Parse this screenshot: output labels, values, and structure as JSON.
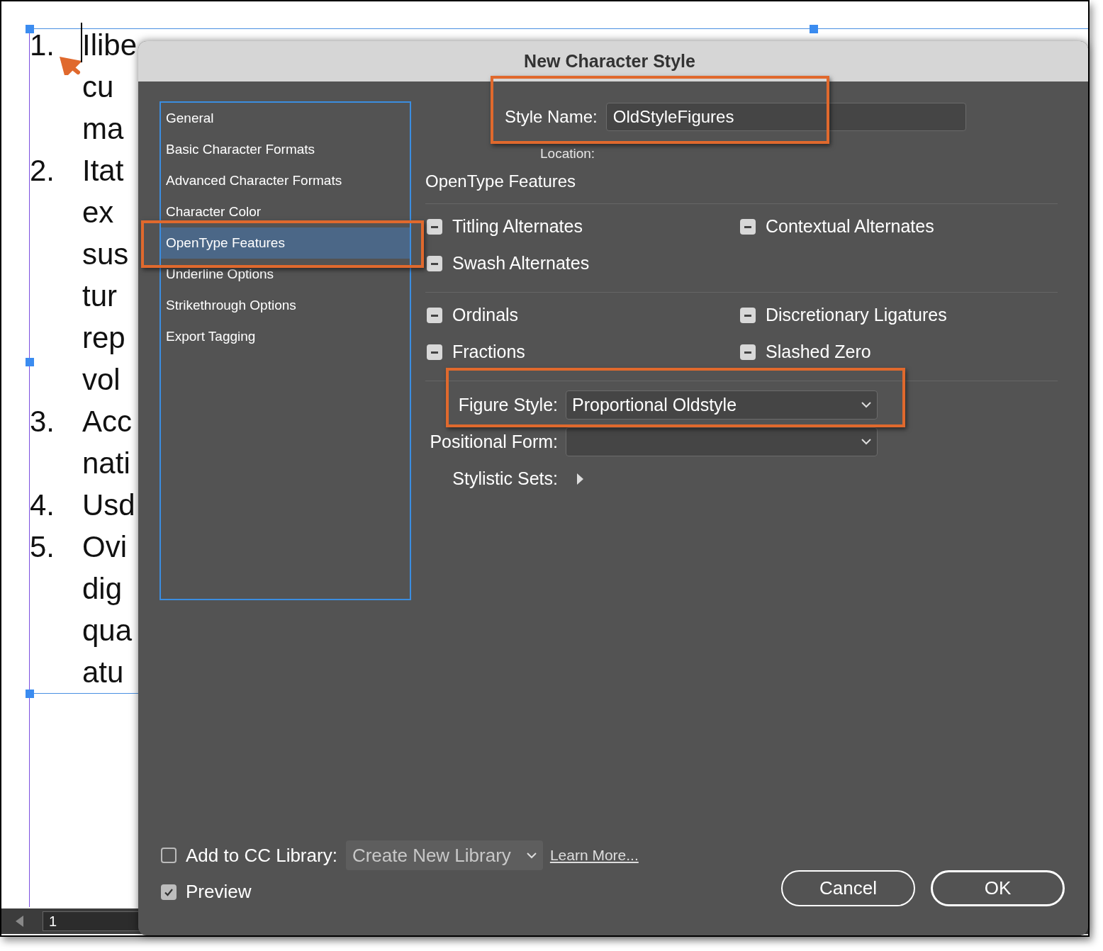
{
  "document": {
    "lines": [
      {
        "number": "1.",
        "text": "Ilibe"
      },
      {
        "text": "cu"
      },
      {
        "text": "ma"
      },
      {
        "number": "2.",
        "text": "Itat"
      },
      {
        "text": "ex"
      },
      {
        "text": "sus"
      },
      {
        "text": "tur"
      },
      {
        "text": "rep"
      },
      {
        "text": "vol"
      },
      {
        "number": "3.",
        "text": "Acc"
      },
      {
        "text": "nati"
      },
      {
        "number": "4.",
        "text": "Usd"
      },
      {
        "number": "5.",
        "text": "Ovi"
      },
      {
        "text": "dig"
      },
      {
        "text": "qua"
      },
      {
        "text": "atu"
      }
    ],
    "page_field": "1"
  },
  "dialog": {
    "title": "New Character Style",
    "sidebar": [
      {
        "label": "General",
        "selected": false
      },
      {
        "label": "Basic Character Formats",
        "selected": false
      },
      {
        "label": "Advanced Character Formats",
        "selected": false
      },
      {
        "label": "Character Color",
        "selected": false
      },
      {
        "label": "OpenType Features",
        "selected": true
      },
      {
        "label": "Underline Options",
        "selected": false
      },
      {
        "label": "Strikethrough Options",
        "selected": false
      },
      {
        "label": "Export Tagging",
        "selected": false
      }
    ],
    "style_name": {
      "label": "Style Name:",
      "value": "OldStyleFigures"
    },
    "location_label": "Location:",
    "section_title": "OpenType Features",
    "feature_groups": [
      [
        {
          "label": "Titling Alternates",
          "mixed": true
        },
        {
          "label": "Contextual Alternates",
          "mixed": true
        },
        {
          "label": "Swash Alternates",
          "mixed": true
        }
      ],
      [
        {
          "label": "Ordinals",
          "mixed": true
        },
        {
          "label": "Discretionary Ligatures",
          "mixed": true
        },
        {
          "label": "Fractions",
          "mixed": true
        },
        {
          "label": "Slashed Zero",
          "mixed": true
        }
      ]
    ],
    "figure_style": {
      "label": "Figure Style:",
      "value": "Proportional Oldstyle"
    },
    "positional_form": {
      "label": "Positional Form:"
    },
    "stylistic_sets": {
      "label": "Stylistic Sets:",
      "expanded": false
    },
    "add_to_library": {
      "label": "Add to CC Library:",
      "checked": false
    },
    "library_dropdown": {
      "value": "Create New Library"
    },
    "learn_more": "Learn More...",
    "preview": {
      "label": "Preview",
      "checked": true
    },
    "buttons": [
      "Cancel",
      "OK"
    ]
  }
}
